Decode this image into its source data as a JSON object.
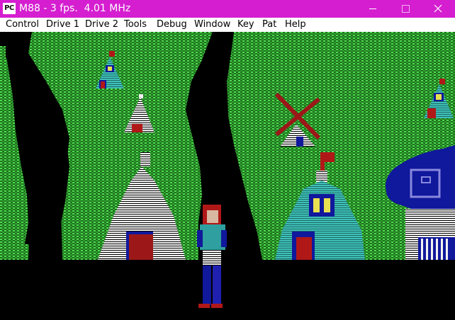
{
  "window": {
    "title": "M88 - 3 fps.  4.01 MHz",
    "app_icon_label": "PC"
  },
  "menu": [
    "Control",
    "Drive 1",
    "Drive 2",
    "Tools",
    "Debug",
    "Window",
    "Key",
    "Pat",
    "Help"
  ],
  "colors": {
    "titlebar": "#d51ed0",
    "grass": "#2e8f2e",
    "grass_dot": "#55ee55",
    "path": "#000000",
    "cyan": "#39b5ad",
    "navy": "#10189c",
    "red": "#9c1818",
    "white": "#ffffff"
  },
  "scene": {
    "description_icons": [
      "hut-icon",
      "windmill-icon",
      "house-icon",
      "character-sprite"
    ]
  }
}
